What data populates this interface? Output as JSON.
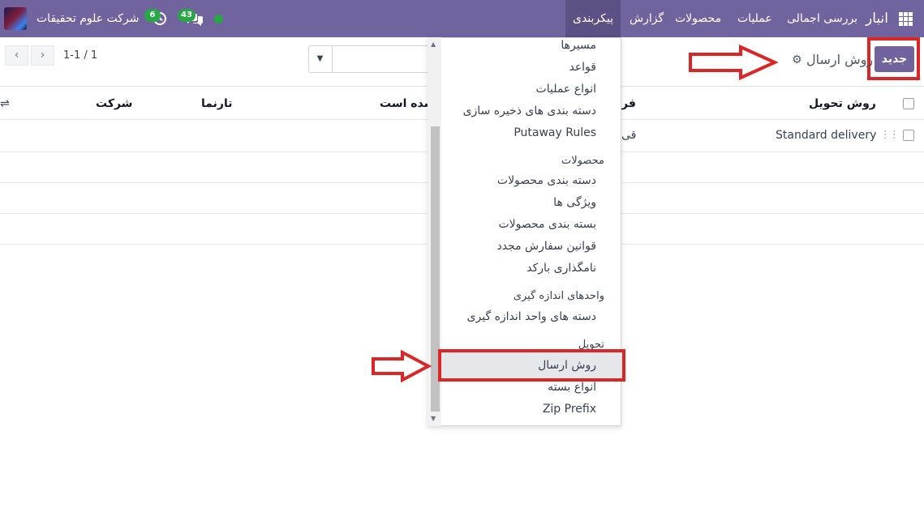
{
  "navbar": {
    "brand": "انبار",
    "menu": [
      "بررسی اجمالی",
      "عملیات",
      "محصولات",
      "گزارش",
      "پیکربندی"
    ],
    "company": "شرکت علوم تحقیقات",
    "activity_count": "6",
    "messages_count": "43",
    "color": "#71639e"
  },
  "control": {
    "new_button": "جدید",
    "breadcrumb": "روش ارسال",
    "pager": "1-1 / 1"
  },
  "table": {
    "columns": [
      "روش تحویل",
      "فر",
      "شده است",
      "تارنما",
      "شرکت"
    ],
    "rows": [
      {
        "name": "Standard delivery",
        "col2": "قی"
      }
    ]
  },
  "dropdown": {
    "sections": [
      {
        "header": "",
        "items": [
          "مسیرها",
          "قواعد",
          "انواع عملیات",
          "دسته بندی های ذخیره سازی",
          "Putaway Rules"
        ]
      },
      {
        "header": "محصولات",
        "items": [
          "دسته بندی محصولات",
          "ویژگی ها",
          "بسته بندی محصولات",
          "قوانین سفارش مجدد",
          "نامگذاری بارکد"
        ]
      },
      {
        "header": "واحدهای اندازه گیری",
        "items": [
          "دسته های واحد اندازه گیری"
        ]
      },
      {
        "header": "تحویل",
        "items": [
          "روش ارسال",
          "انواع بسته",
          "Zip Prefix"
        ]
      }
    ],
    "active_item": "روش ارسال"
  },
  "icons": {
    "apps": "apps-grid-icon",
    "settings": "gear-icon",
    "chat": "chat-icon",
    "activity": "clock-icon",
    "annotation_color": "#dc2626"
  }
}
